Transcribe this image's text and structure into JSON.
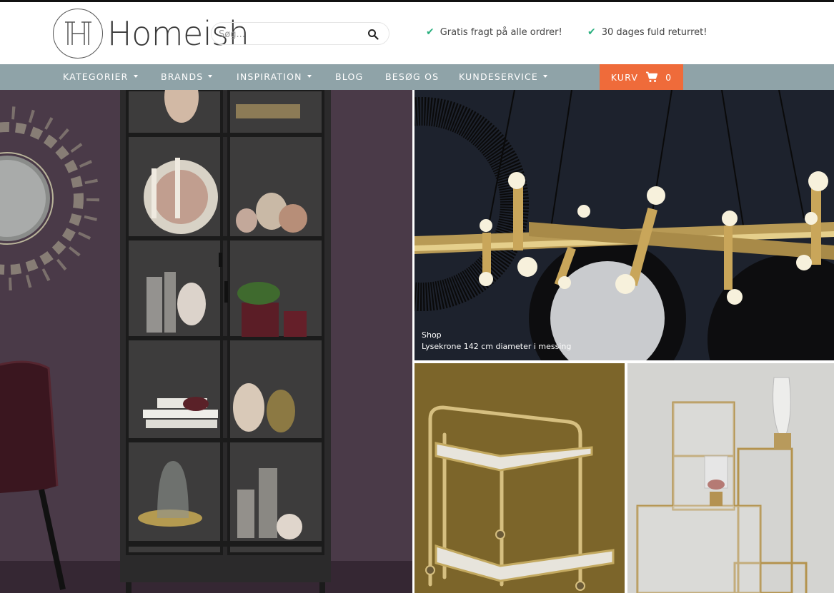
{
  "header": {
    "logo_text": "Homeish",
    "search": {
      "placeholder": "Søg..."
    },
    "usps": [
      "Gratis fragt på alle ordrer!",
      "30 dages fuld returret!"
    ]
  },
  "nav": {
    "items": [
      {
        "label": "KATEGORIER",
        "dropdown": true
      },
      {
        "label": "BRANDS",
        "dropdown": true
      },
      {
        "label": "INSPIRATION",
        "dropdown": true
      },
      {
        "label": "BLOG",
        "dropdown": false
      },
      {
        "label": "BESØG OS",
        "dropdown": false
      },
      {
        "label": "KUNDESERVICE",
        "dropdown": true
      }
    ],
    "cart": {
      "label": "KURV",
      "count": "0"
    }
  },
  "tiles": {
    "featured": {
      "kicker": "Shop",
      "title": "Lysekrone 142 cm diameter i messing"
    }
  },
  "colors": {
    "nav_bg": "#8fa3a8",
    "cart_bg": "#ef6b3a",
    "check": "#2bb07f"
  }
}
